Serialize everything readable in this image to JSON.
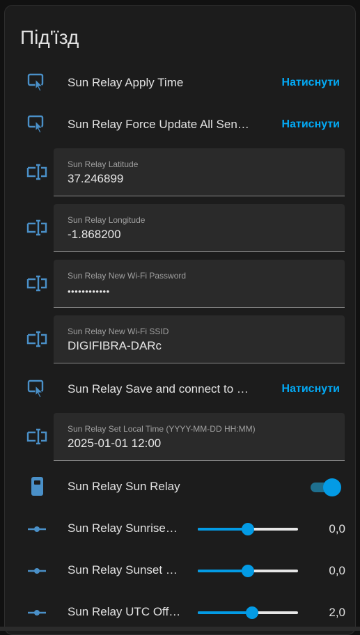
{
  "card": {
    "title": "Під'їзд",
    "accent_color": "#03a9f4",
    "press_label": "Натиснути"
  },
  "rows": {
    "apply_time": {
      "label": "Sun Relay Apply Time",
      "icon": "button-press-icon"
    },
    "force_update": {
      "label": "Sun Relay Force Update All Sensors",
      "icon": "button-press-icon"
    },
    "latitude": {
      "label": "Sun Relay Latitude",
      "value": "37.246899",
      "icon": "text-input-icon"
    },
    "longitude": {
      "label": "Sun Relay Longitude",
      "value": "-1.868200",
      "icon": "text-input-icon"
    },
    "wifi_password": {
      "label": "Sun Relay New Wi-Fi Password",
      "value": "••••••••••••",
      "icon": "text-input-icon"
    },
    "wifi_ssid": {
      "label": "Sun Relay New Wi-Fi SSID",
      "value": "DIGIFIBRA-DARc",
      "icon": "text-input-icon"
    },
    "save_connect": {
      "label": "Sun Relay Save and connect to network",
      "icon": "button-press-icon"
    },
    "local_time": {
      "label": "Sun Relay Set Local Time (YYYY-MM-DD HH:MM)",
      "value": "2025-01-01 12:00",
      "icon": "text-input-icon"
    },
    "sun_relay": {
      "label": "Sun Relay Sun Relay",
      "state": "on",
      "icon": "relay-switch-icon"
    },
    "sunrise_offset": {
      "label": "Sun Relay Sunrise Offset",
      "value": "0,0",
      "fraction": 0.5,
      "icon": "slider-icon"
    },
    "sunset_offset": {
      "label": "Sun Relay Sunset Offset",
      "value": "0,0",
      "fraction": 0.5,
      "icon": "slider-icon"
    },
    "utc_offset": {
      "label": "Sun Relay UTC Offset",
      "value": "2,0",
      "fraction": 0.54,
      "icon": "slider-icon"
    }
  }
}
